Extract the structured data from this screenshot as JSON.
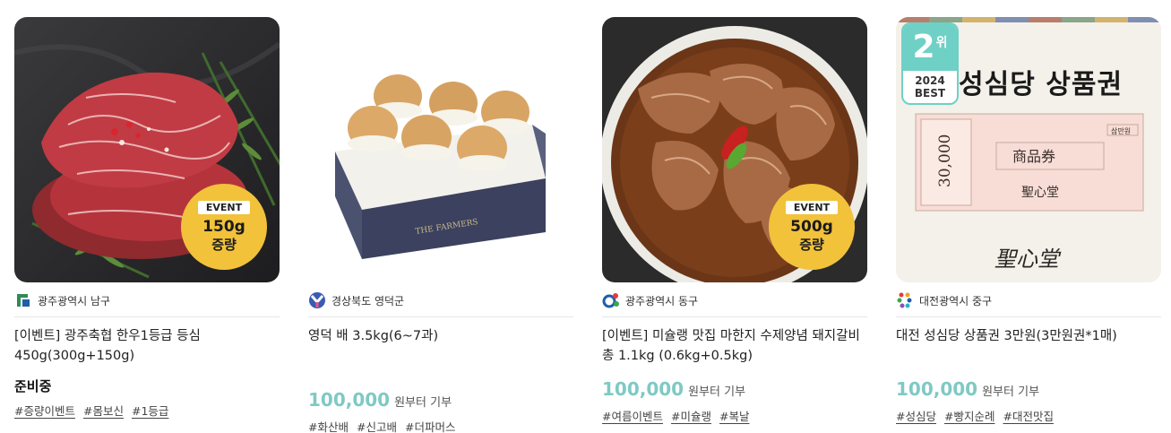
{
  "products": [
    {
      "region": "광주광역시 남구",
      "title": "[이벤트] 광주축협 한우1등급 등심 450g(300g+150g)",
      "status": "준비중",
      "tags": [
        "#증량이벤트",
        "#몸보신",
        "#1등급"
      ],
      "badge": {
        "label": "EVENT",
        "amount": "150g",
        "increase": "증량"
      }
    },
    {
      "region": "경상북도 영덕군",
      "title": "영덕 배 3.5kg(6~7과)",
      "price": "100,000",
      "price_suffix": "원부터 기부",
      "tags": [
        "#화산배",
        "#신고배",
        "#더파머스"
      ],
      "box_text": "THE FARMERS"
    },
    {
      "region": "광주광역시 동구",
      "title": "[이벤트] 미슐랭 맛집 마한지 수제양념 돼지갈비 총 1.1kg (0.6kg+0.5kg)",
      "price": "100,000",
      "price_suffix": "원부터 기부",
      "tags": [
        "#여름이벤트",
        "#미슐랭",
        "#복날"
      ],
      "badge": {
        "label": "EVENT",
        "amount": "500g",
        "increase": "증량"
      }
    },
    {
      "region": "대전광역시 중구",
      "title": "대전 성심당 상품권 3만원(3만원권*1매)",
      "price": "100,000",
      "price_suffix": "원부터 기부",
      "tags": [
        "#성심당",
        "#빵지순례",
        "#대전맛집"
      ],
      "rank": {
        "number": "2",
        "unit": "위",
        "year": "2024",
        "label": "BEST"
      },
      "voucher": {
        "heading": "성심당 상품권",
        "amount": "30,000",
        "name": "商品券",
        "denom": "삼만원",
        "brand": "聖心堂"
      }
    }
  ],
  "colors": {
    "price": "#7fc9c4",
    "event_badge": "#f2c23b",
    "rank_badge": "#6fd0c6"
  }
}
